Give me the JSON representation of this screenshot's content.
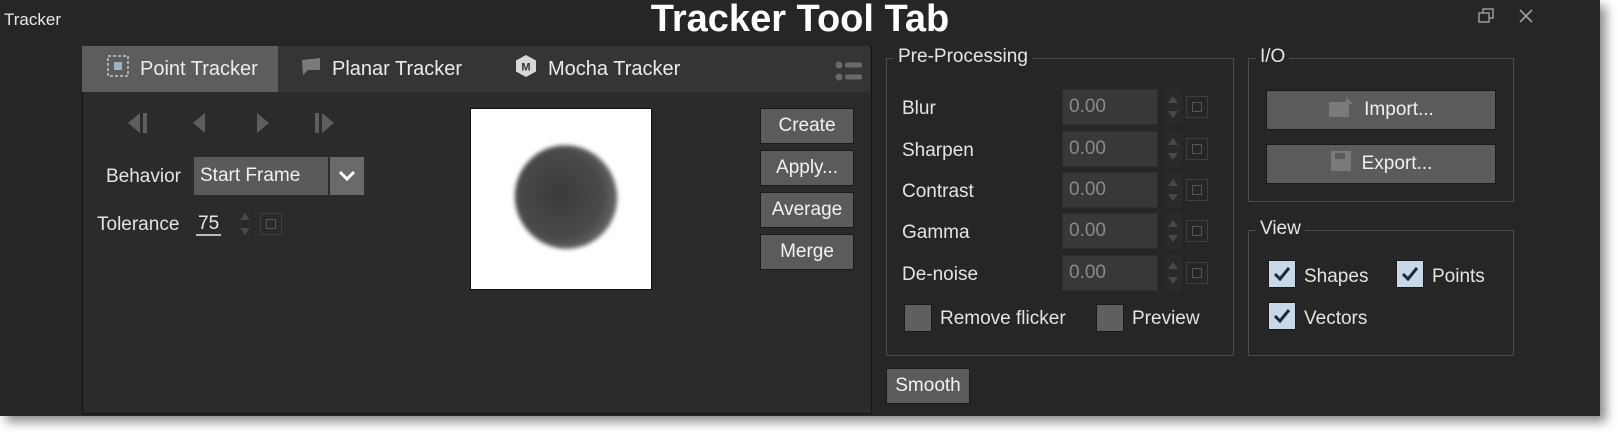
{
  "window": {
    "title": "Tracker",
    "heading": "Tracker Tool Tab"
  },
  "tabs": [
    {
      "label": "Point Tracker",
      "icon": "point-tracker-icon",
      "active": true
    },
    {
      "label": "Planar Tracker",
      "icon": "planar-tracker-icon",
      "active": false
    },
    {
      "label": "Mocha Tracker",
      "icon": "mocha-logo-icon",
      "active": false
    }
  ],
  "nav_buttons": [
    "step-to-first-frame-icon",
    "step-backward-icon",
    "step-forward-icon",
    "step-to-last-frame-icon"
  ],
  "behavior": {
    "label": "Behavior",
    "value": "Start Frame"
  },
  "tolerance": {
    "label": "Tolerance",
    "value": "75"
  },
  "actions": {
    "create": "Create",
    "apply": "Apply...",
    "average": "Average",
    "merge": "Merge",
    "smooth": "Smooth"
  },
  "pre_processing": {
    "title": "Pre-Processing",
    "rows": [
      {
        "label": "Blur",
        "value": "0.00"
      },
      {
        "label": "Sharpen",
        "value": "0.00"
      },
      {
        "label": "Contrast",
        "value": "0.00"
      },
      {
        "label": "Gamma",
        "value": "0.00"
      },
      {
        "label": "De-noise",
        "value": "0.00"
      }
    ],
    "remove_flicker": {
      "label": "Remove flicker",
      "checked": false
    },
    "preview": {
      "label": "Preview",
      "checked": false
    }
  },
  "io": {
    "title": "I/O",
    "import_label": "Import...",
    "export_label": "Export..."
  },
  "view": {
    "title": "View",
    "shapes": {
      "label": "Shapes",
      "checked": true
    },
    "points": {
      "label": "Points",
      "checked": true
    },
    "vectors": {
      "label": "Vectors",
      "checked": true
    }
  },
  "colors": {
    "panel": "#262626",
    "button": "#5b5b5b",
    "active_tab": "#5d5d5d",
    "checkbox_checked": "#c8d8e8"
  }
}
